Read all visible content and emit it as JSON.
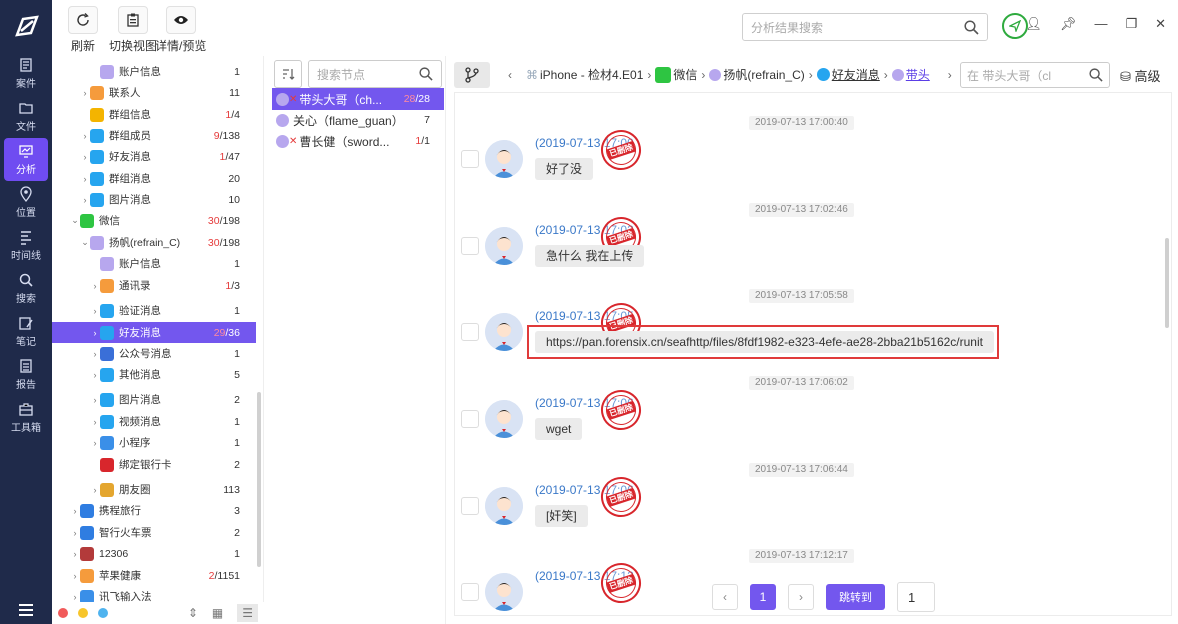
{
  "nav": {
    "items": [
      {
        "label": "案件",
        "icon": "case-icon"
      },
      {
        "label": "文件",
        "icon": "folder-icon"
      },
      {
        "label": "分析",
        "icon": "analysis-icon"
      },
      {
        "label": "位置",
        "icon": "location-icon"
      },
      {
        "label": "时间线",
        "icon": "timeline-icon"
      },
      {
        "label": "搜索",
        "icon": "search-icon"
      },
      {
        "label": "笔记",
        "icon": "note-icon"
      },
      {
        "label": "报告",
        "icon": "report-icon"
      },
      {
        "label": "工具箱",
        "icon": "toolbox-icon"
      }
    ]
  },
  "toolbar": {
    "refresh": "刷新",
    "switch_view": "切换视图",
    "details": "详情/预览",
    "search_placeholder": "分析结果搜索"
  },
  "tree": {
    "items": [
      {
        "label": "账户信息",
        "red": "",
        "total": "1",
        "arrow": "",
        "color": "#b7a7ee"
      },
      {
        "label": "联系人",
        "red": "",
        "total": "11",
        "arrow": "›",
        "color": "#f59b3c"
      },
      {
        "label": "群组信息",
        "red": "1",
        "total": "/4",
        "arrow": "",
        "color": "#f4b400"
      },
      {
        "label": "群组成员",
        "red": "9",
        "total": "/138",
        "arrow": "›",
        "color": "#26a5ef"
      },
      {
        "label": "好友消息",
        "red": "1",
        "total": "/47",
        "arrow": "›",
        "color": "#26a5ef"
      },
      {
        "label": "群组消息",
        "red": "",
        "total": "20",
        "arrow": "›",
        "color": "#26a5ef"
      },
      {
        "label": "图片消息",
        "red": "",
        "total": "10",
        "arrow": "›",
        "color": "#26a5ef"
      },
      {
        "label": "微信",
        "red": "30",
        "total": "/198",
        "arrow": "⌄",
        "color": "#2ec542"
      },
      {
        "label": "扬帆(refrain_C)",
        "red": "30",
        "total": "/198",
        "arrow": "⌄",
        "color": "#b7a7ee"
      },
      {
        "label": "账户信息",
        "red": "",
        "total": "1",
        "arrow": "",
        "color": "#b7a7ee"
      },
      {
        "label": "通讯录",
        "red": "1",
        "total": "/3",
        "arrow": "›",
        "color": "#f59b3c"
      },
      {
        "label": "验证消息",
        "red": "",
        "total": "1",
        "arrow": "›",
        "color": "#26a5ef"
      },
      {
        "label": "好友消息",
        "red": "29",
        "total": "/36",
        "arrow": "›",
        "color": "#26a5ef"
      },
      {
        "label": "公众号消息",
        "red": "",
        "total": "1",
        "arrow": "›",
        "color": "#3a6fd8"
      },
      {
        "label": "其他消息",
        "red": "",
        "total": "5",
        "arrow": "›",
        "color": "#26a5ef"
      },
      {
        "label": "图片消息",
        "red": "",
        "total": "2",
        "arrow": "›",
        "color": "#26a5ef"
      },
      {
        "label": "视频消息",
        "red": "",
        "total": "1",
        "arrow": "›",
        "color": "#26a5ef"
      },
      {
        "label": "小程序",
        "red": "",
        "total": "1",
        "arrow": "›",
        "color": "#3a8fe8"
      },
      {
        "label": "绑定银行卡",
        "red": "",
        "total": "2",
        "arrow": "",
        "color": "#d8262c"
      },
      {
        "label": "朋友圈",
        "red": "",
        "total": "113",
        "arrow": "›",
        "color": "#e4a62f"
      },
      {
        "label": "携程旅行",
        "red": "",
        "total": "3",
        "arrow": "›",
        "color": "#2f7de1"
      },
      {
        "label": "智行火车票",
        "red": "",
        "total": "2",
        "arrow": "›",
        "color": "#2f7de1"
      },
      {
        "label": "12306",
        "red": "",
        "total": "1",
        "arrow": "›",
        "color": "#b33a3a"
      },
      {
        "label": "苹果健康",
        "red": "2",
        "total": "/1151",
        "arrow": "›",
        "color": "#f59b3c"
      },
      {
        "label": "讯飞输入法",
        "red": "",
        "total": "",
        "arrow": "›",
        "color": "#3a8fe8"
      }
    ]
  },
  "nodes": {
    "search_placeholder": "搜索节点",
    "items": [
      {
        "label": "带头大哥（ch...",
        "red": "28",
        "total": "/28"
      },
      {
        "label": "关心（flame_guan）",
        "red": "",
        "total": "7"
      },
      {
        "label": "曹长健（sword...",
        "red": "1",
        "total": "/1"
      }
    ]
  },
  "breadcrumb": {
    "device": "iPhone - 检材4.E01",
    "app": "微信",
    "account": "扬帆(refrain_C)",
    "category": "好友消息",
    "contact": "带头"
  },
  "chat": {
    "search_placeholder": "在 带头大哥（cl",
    "advanced": "高级",
    "messages": [
      {
        "time": "2019-07-13 17:00:40",
        "sender": "(2019-07-13 17:00",
        "text": "好了没"
      },
      {
        "time": "2019-07-13 17:02:46",
        "sender": "(2019-07-13 17:02",
        "text": "急什么 我在上传"
      },
      {
        "time": "2019-07-13 17:05:58",
        "sender": "(2019-07-13 17:05",
        "text": "https://pan.forensix.cn/seafhttp/files/8fdf1982-e323-4efe-ae28-2bba21b5162c/runit"
      },
      {
        "time": "2019-07-13 17:06:02",
        "sender": "(2019-07-13 17:06",
        "text": "wget"
      },
      {
        "time": "2019-07-13 17:06:44",
        "sender": "(2019-07-13 17:06",
        "text": "[奸笑]"
      },
      {
        "time": "2019-07-13 17:12:17",
        "sender": "(2019-07-13 17:12",
        "text": ""
      }
    ],
    "stamp": "已删除"
  },
  "pager": {
    "current": "1",
    "jump": "跳转到",
    "input": "1"
  },
  "colors": {
    "rail": "#1f2a4a",
    "accent": "#7357ee",
    "highlight": "#e03a3a"
  }
}
